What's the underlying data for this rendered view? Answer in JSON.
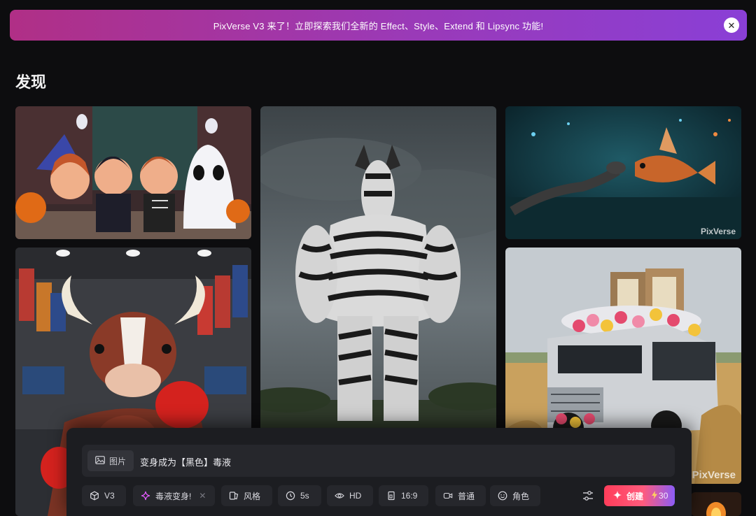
{
  "banner": {
    "text": "PixVerse V3 来了！立即探索我们全新的 Effect、Style、Extend 和 Lipsync 功能!",
    "close_icon": "close-icon"
  },
  "page": {
    "title": "发现"
  },
  "gallery": {
    "watermark": "PixVerse",
    "tiles": [
      {
        "name": "halloween-kids",
        "watermark": ""
      },
      {
        "name": "zebra-warrior",
        "watermark": ""
      },
      {
        "name": "snake-fish",
        "watermark": "PixVerse"
      },
      {
        "name": "boxing-bull",
        "watermark": ""
      },
      {
        "name": "flower-truck",
        "watermark": "PixVerse"
      }
    ]
  },
  "prompt": {
    "image_label": "图片",
    "text": "变身成为【黑色】毒液"
  },
  "toolbar": {
    "model": "V3",
    "effect": "毒液变身!",
    "style": "风格",
    "duration": "5s",
    "quality": "HD",
    "ratio": "16:9",
    "motion": "普通",
    "character": "角色",
    "create_label": "创建",
    "credits": "30"
  },
  "colors": {
    "accent_start": "#ff3d5a",
    "accent_end": "#8b5cf6",
    "banner_start": "#b02f86",
    "banner_end": "#8a3fd6"
  }
}
